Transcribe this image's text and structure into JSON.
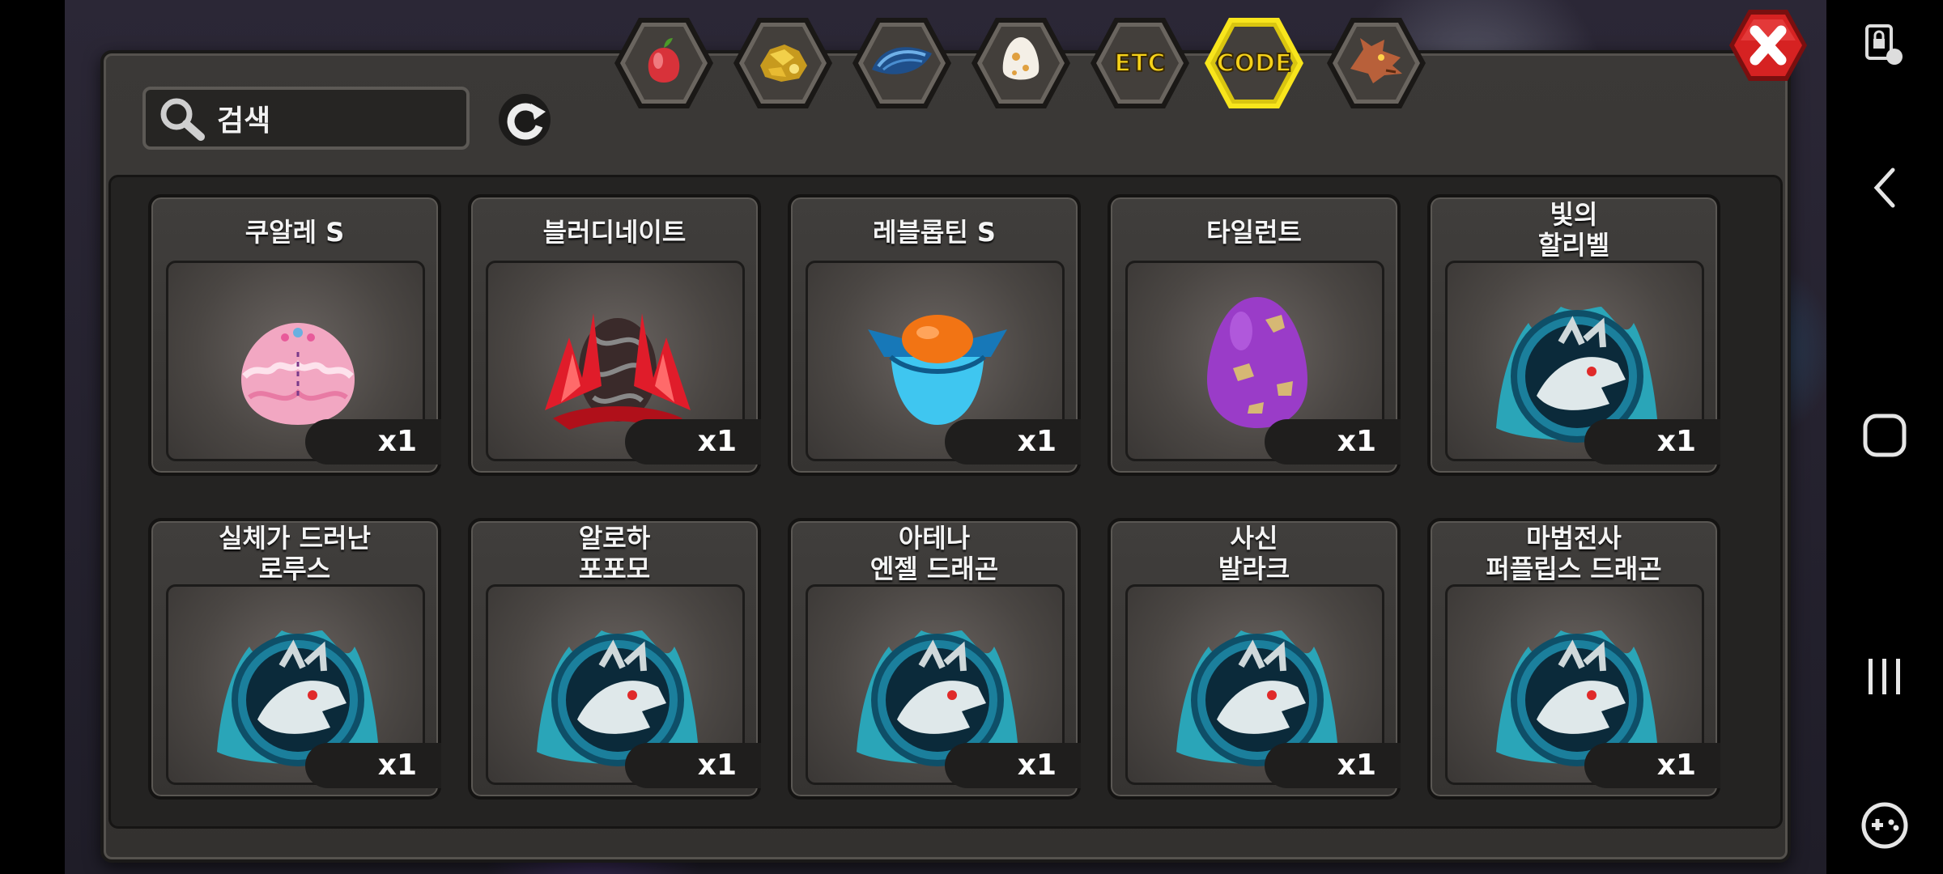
{
  "search": {
    "icon": "search-icon",
    "placeholder": "검색"
  },
  "tabs": [
    {
      "icon": "fruit-icon",
      "label": ""
    },
    {
      "icon": "gold-ore-icon",
      "label": ""
    },
    {
      "icon": "scale-icon",
      "label": ""
    },
    {
      "icon": "egg-icon",
      "label": ""
    },
    {
      "icon": "",
      "label": "ETC"
    },
    {
      "icon": "",
      "label": "CODE",
      "selected": true
    },
    {
      "icon": "dragon-head-icon",
      "label": ""
    }
  ],
  "items": [
    {
      "name": "쿠알레 S",
      "qty": "x1",
      "icon": "pink-egg-icon"
    },
    {
      "name": "블러디네이트",
      "qty": "x1",
      "icon": "red-egg-icon"
    },
    {
      "name": "레블롭틴 S",
      "qty": "x1",
      "icon": "blue-egg-icon"
    },
    {
      "name": "타일런트",
      "qty": "x1",
      "icon": "purple-egg-icon"
    },
    {
      "name": "빛의\n할리벨",
      "qty": "x1",
      "icon": "dragon-portrait-icon"
    },
    {
      "name": "실체가 드러난\n로루스",
      "qty": "x1",
      "icon": "dragon-portrait-icon"
    },
    {
      "name": "알로하\n포포모",
      "qty": "x1",
      "icon": "dragon-portrait-icon"
    },
    {
      "name": "아테나\n엔젤 드래곤",
      "qty": "x1",
      "icon": "dragon-portrait-icon"
    },
    {
      "name": "사신\n발라크",
      "qty": "x1",
      "icon": "dragon-portrait-icon"
    },
    {
      "name": "마법전사\n퍼플립스 드래곤",
      "qty": "x1",
      "icon": "dragon-portrait-icon"
    }
  ],
  "colors": {
    "accent": "#f6d21a",
    "close_red": "#d62222",
    "panel": "#3b3937"
  }
}
